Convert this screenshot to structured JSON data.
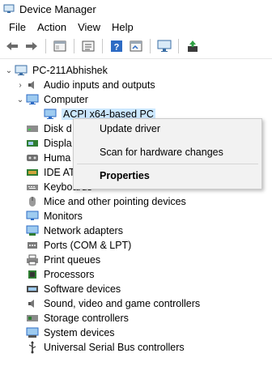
{
  "window": {
    "title": "Device Manager"
  },
  "menu": [
    "File",
    "Action",
    "View",
    "Help"
  ],
  "toolbar": [
    "back-icon",
    "forward-icon",
    "properties-icon",
    "show-hidden-icon",
    "help-icon",
    "action-icon",
    "monitor-icon",
    "update-driver-icon"
  ],
  "tree": {
    "root": "PC-211Abhishek",
    "computer": "Computer",
    "computer_child": "ACPI x64-based PC",
    "categories": [
      "Audio inputs and outputs",
      "Disk d",
      "Displa",
      "Huma",
      "IDE AT",
      "Keyboards",
      "Mice and other pointing devices",
      "Monitors",
      "Network adapters",
      "Ports (COM & LPT)",
      "Print queues",
      "Processors",
      "Software devices",
      "Sound, video and game controllers",
      "Storage controllers",
      "System devices",
      "Universal Serial Bus controllers"
    ]
  },
  "context_menu": {
    "update_driver": "Update driver",
    "scan": "Scan for hardware changes",
    "properties": "Properties"
  },
  "colors": {
    "selection": "#cce8ff",
    "accent": "#1e7bd6"
  }
}
